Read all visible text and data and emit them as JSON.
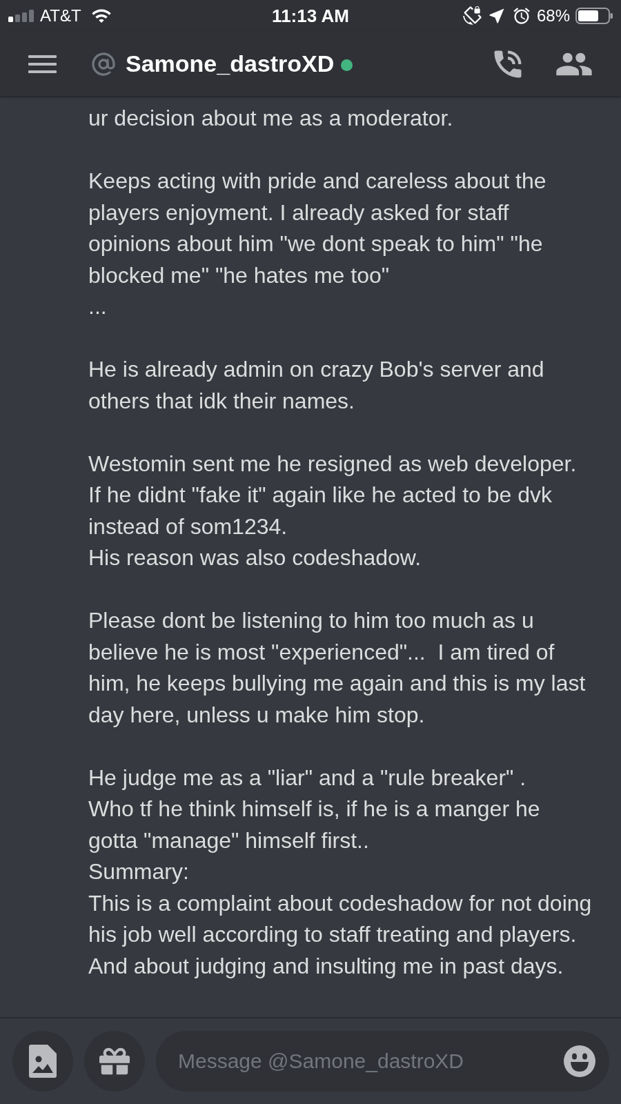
{
  "status_bar": {
    "carrier": "AT&T",
    "time": "11:13 AM",
    "battery": "68%"
  },
  "header": {
    "channel_name": "Samone_dastroXD",
    "online": true
  },
  "message": {
    "paragraphs": [
      {
        "lines": [
          "ur decision about me as a moderator."
        ]
      },
      {
        "lines": [
          "Keeps acting with pride and careless about the",
          "players enjoyment. I already asked for staff",
          "opinions about him \"we dont speak to him\" \"he",
          "blocked me\" \"he hates me too\"",
          "..."
        ]
      },
      {
        "lines": [
          "He is already admin on crazy Bob's server and",
          "others that idk their names."
        ]
      },
      {
        "lines": [
          "Westomin sent me he resigned as web developer.",
          "If he didnt \"fake it\" again like he acted to be dvk",
          "instead of som1234.",
          "His reason was also codeshadow."
        ]
      },
      {
        "lines": [
          "Please dont be listening to him too much as u",
          "believe he is most \"experienced\"...  I am tired of",
          "him, he keeps bullying me again and this is my last",
          "day here, unless u make him stop."
        ]
      },
      {
        "lines": [
          "He judge me as a \"liar\" and a \"rule breaker\" .",
          "Who tf he think himself is, if he is a manger he",
          "gotta \"manage\" himself first..",
          "Summary:",
          "This is a complaint about codeshadow for not doing",
          "his job well according to staff treating and players.",
          "And about judging and insulting me in past days."
        ]
      }
    ]
  },
  "composer": {
    "placeholder": "Message @Samone_dastroXD"
  }
}
